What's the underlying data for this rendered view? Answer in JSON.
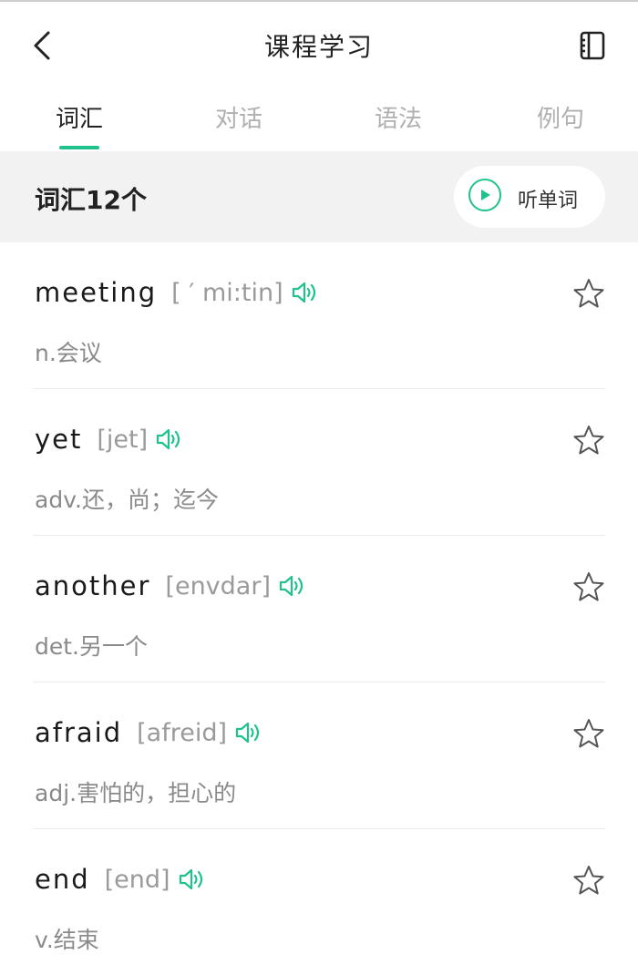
{
  "header": {
    "title": "课程学习",
    "back_icon": "chevron-left-icon",
    "book_icon": "book-icon"
  },
  "tabs": [
    {
      "label": "词汇",
      "active": true
    },
    {
      "label": "对话",
      "active": false
    },
    {
      "label": "语法",
      "active": false
    },
    {
      "label": "例句",
      "active": false
    }
  ],
  "summary": {
    "label": "词汇12个",
    "listen_button": "听单词"
  },
  "words": [
    {
      "word": "meeting",
      "phonetic": "[ ′ mi:tin]",
      "meaning": "n.会议"
    },
    {
      "word": "yet",
      "phonetic": "[jet]",
      "meaning": "adv.还，尚；迄今"
    },
    {
      "word": "another",
      "phonetic": "[envdar]",
      "meaning": "det.另一个"
    },
    {
      "word": "afraid",
      "phonetic": "[afreid]",
      "meaning": "adj.害怕的，担心的"
    },
    {
      "word": "end",
      "phonetic": "[end]",
      "meaning": "v.结束"
    }
  ],
  "colors": {
    "accent": "#1fc28c",
    "summary_bg": "#f2f2f2",
    "text_primary": "#222222",
    "text_secondary": "#8a8a8a"
  }
}
